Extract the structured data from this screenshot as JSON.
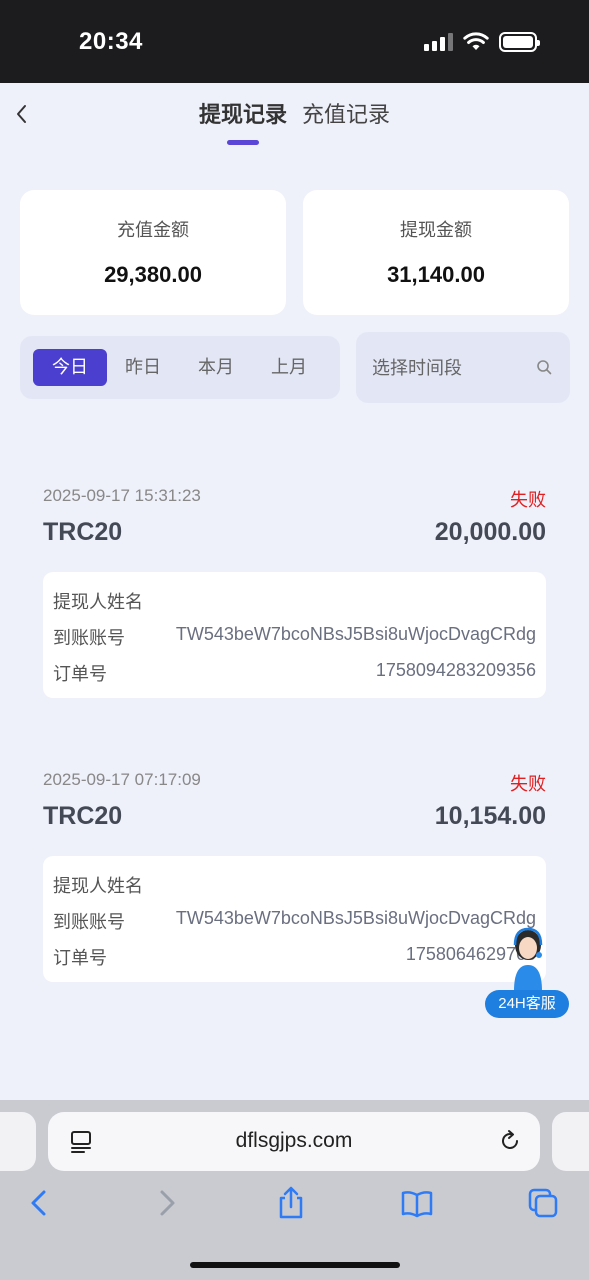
{
  "status_bar": {
    "time": "20:34"
  },
  "header": {
    "tabs": [
      {
        "label": "提现记录",
        "active": true
      },
      {
        "label": "充值记录",
        "active": false
      }
    ]
  },
  "summary": {
    "recharge": {
      "label": "充值金额",
      "value": "29,380.00"
    },
    "withdraw": {
      "label": "提现金额",
      "value": "31,140.00"
    }
  },
  "date_filter": {
    "options": [
      "今日",
      "昨日",
      "本月",
      "上月"
    ],
    "selected": "今日"
  },
  "period_filter": {
    "placeholder": "选择时间段"
  },
  "records": [
    {
      "time": "2025-09-17 15:31:23",
      "status": "失败",
      "chain": "TRC20",
      "amount": "20,000.00",
      "name_label": "提现人姓名",
      "account_label": "到账账号",
      "account": "TW543beW7bcoNBsJ5Bsi8uWjocDvagCRdg",
      "order_label": "订单号",
      "order": "1758094283209356"
    },
    {
      "time": "2025-09-17 07:17:09",
      "status": "失败",
      "chain": "TRC20",
      "amount": "10,154.00",
      "name_label": "提现人姓名",
      "account_label": "到账账号",
      "account": "TW543beW7bcoNBsJ5Bsi8uWjocDvagCRdg",
      "order_label": "订单号",
      "order": "1758064629765"
    }
  ],
  "customer_service": {
    "label": "24H客服"
  },
  "browser": {
    "url": "dflsgjps.com"
  },
  "colors": {
    "accent": "#4b3fcf",
    "fail": "#e02020",
    "cs_badge": "#1e7fe0"
  }
}
